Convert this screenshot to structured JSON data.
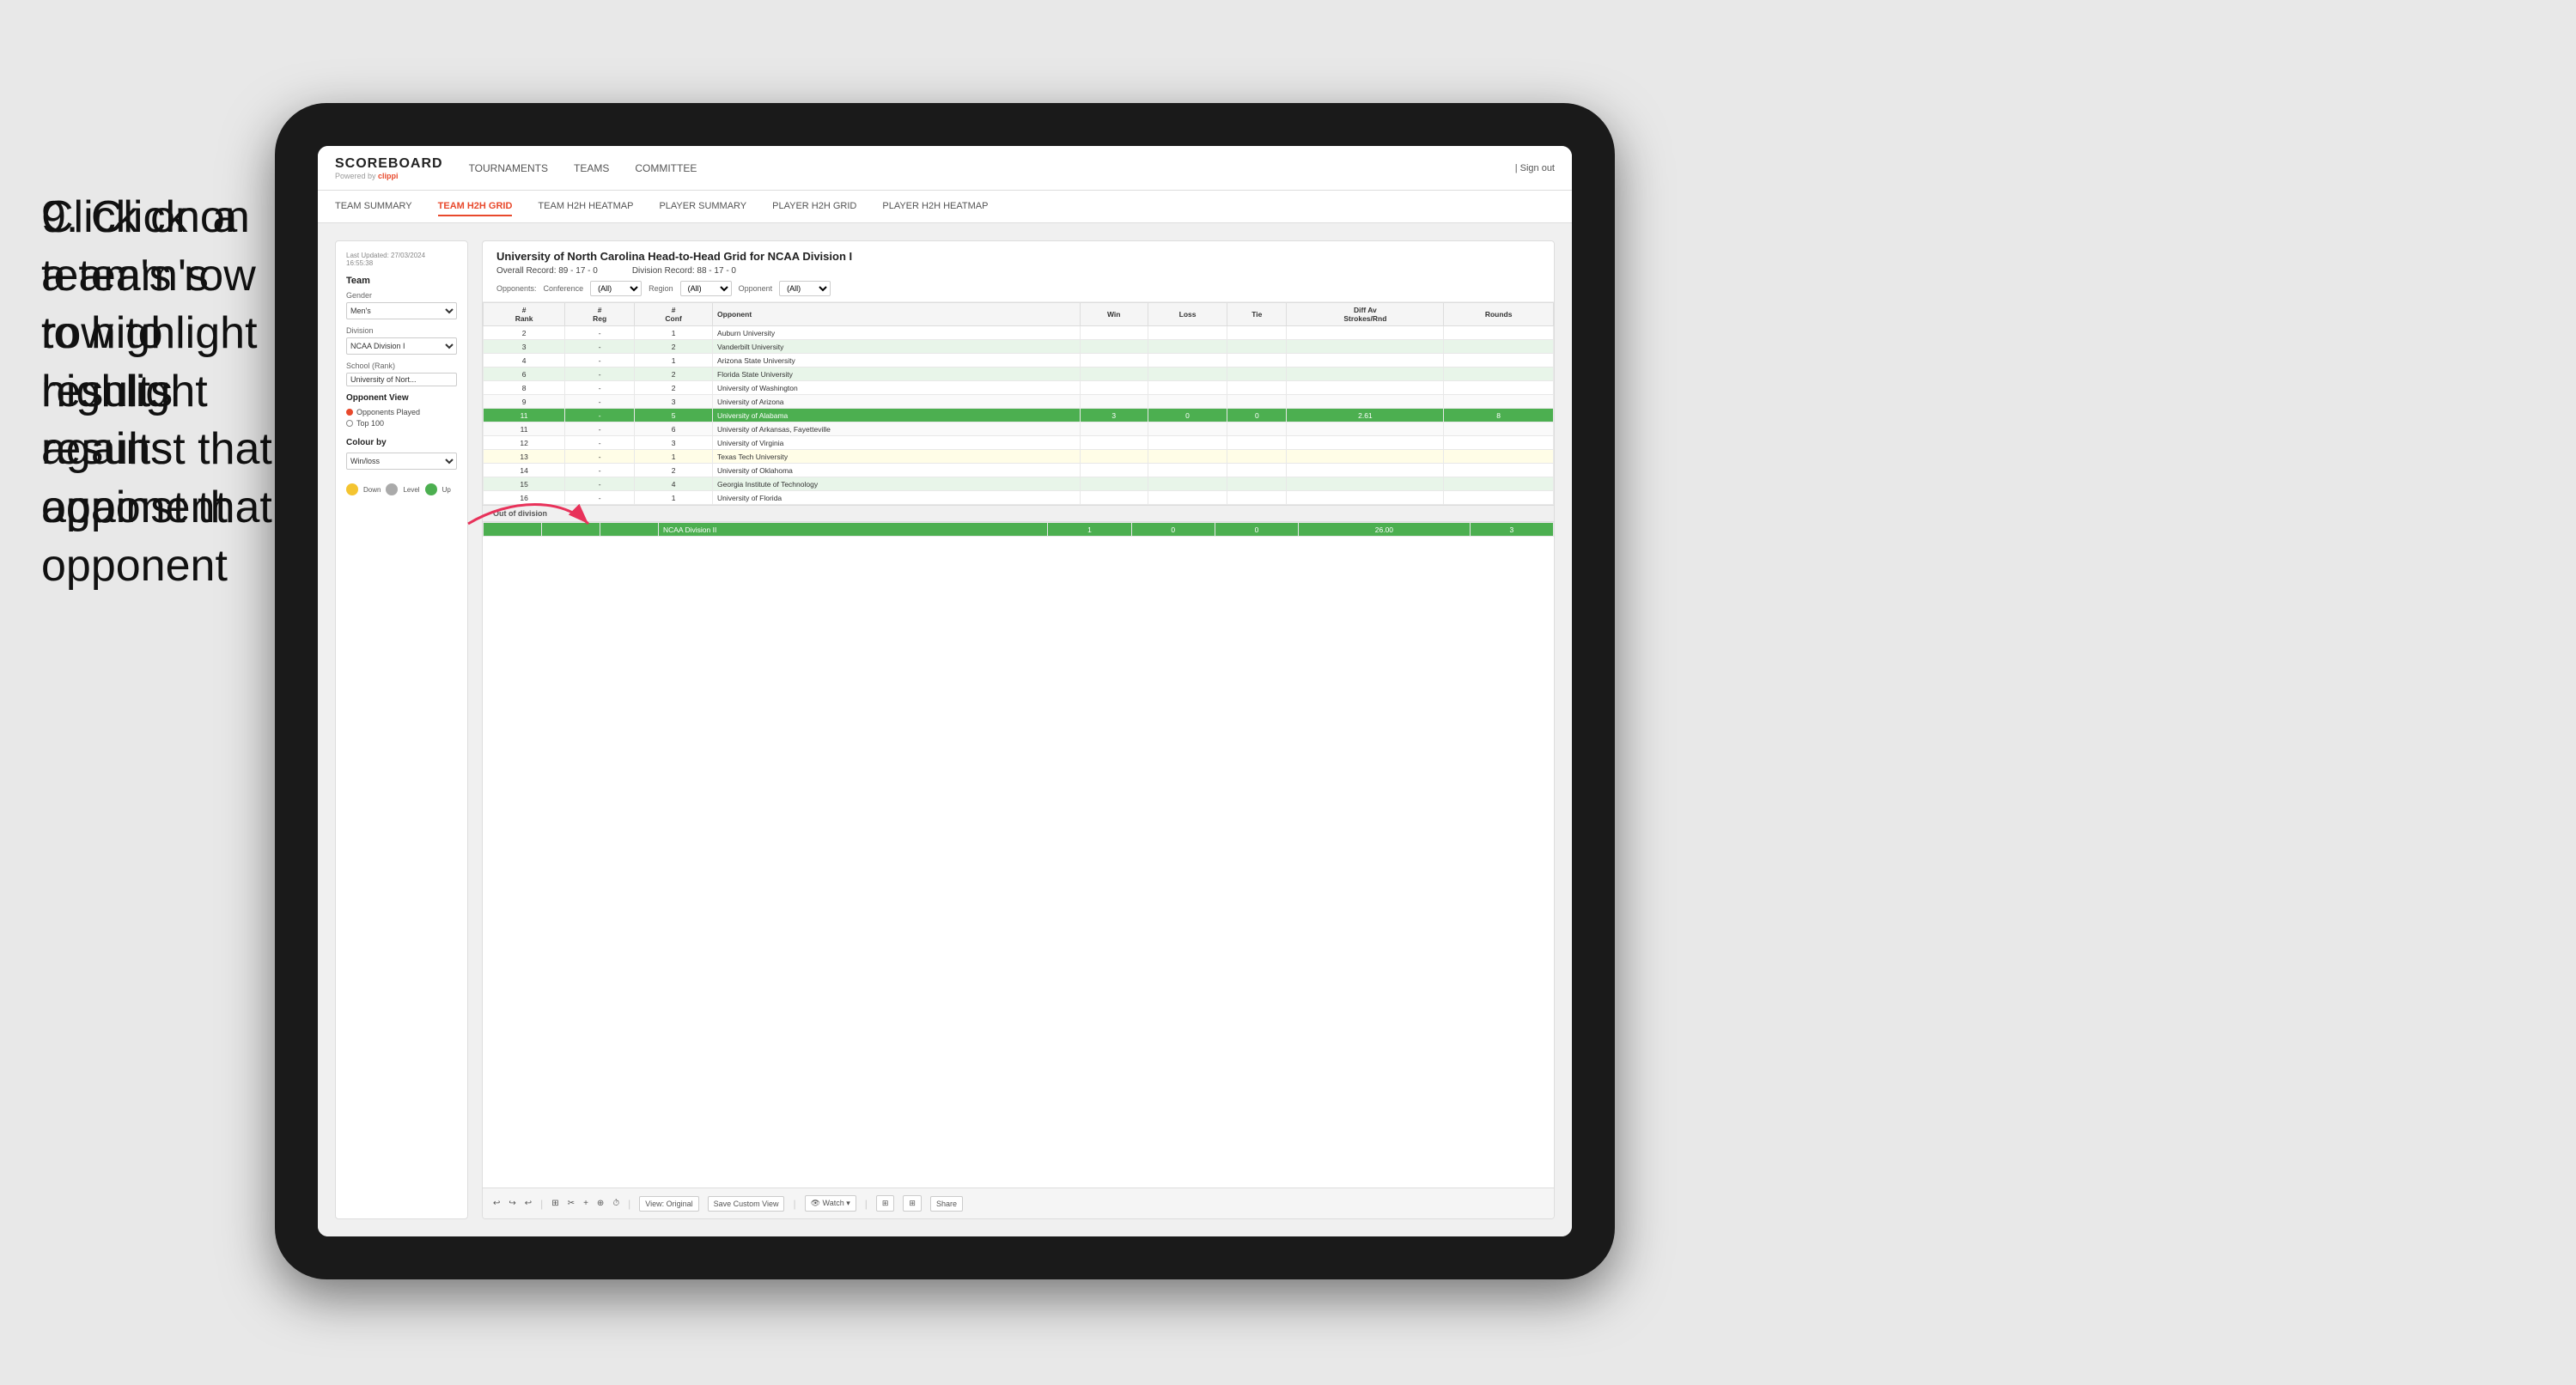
{
  "instruction": {
    "step": "9.",
    "text": "Click on a team's row to highlight results against that opponent"
  },
  "tablet": {
    "topNav": {
      "logo": {
        "title": "SCOREBOARD",
        "subtitle": "Powered by ",
        "brand": "clippi"
      },
      "items": [
        "TOURNAMENTS",
        "TEAMS",
        "COMMITTEE"
      ],
      "signIn": "Sign out"
    },
    "subNav": {
      "items": [
        "TEAM SUMMARY",
        "TEAM H2H GRID",
        "TEAM H2H HEATMAP",
        "PLAYER SUMMARY",
        "PLAYER H2H GRID",
        "PLAYER H2H HEATMAP"
      ],
      "active": "TEAM H2H GRID"
    },
    "leftPanel": {
      "timestamp": "Last Updated: 27/03/2024",
      "time": "16:55:38",
      "teamLabel": "Team",
      "genderLabel": "Gender",
      "genderValue": "Men's",
      "divisionLabel": "Division",
      "divisionValue": "NCAA Division I",
      "schoolLabel": "School (Rank)",
      "schoolValue": "University of Nort...",
      "opponentViewTitle": "Opponent View",
      "radio1": "Opponents Played",
      "radio2": "Top 100",
      "colourByTitle": "Colour by",
      "colourByValue": "Win/loss",
      "legend": [
        {
          "color": "#f4c430",
          "label": "Down"
        },
        {
          "color": "#aaaaaa",
          "label": "Level"
        },
        {
          "color": "#4caf50",
          "label": "Up"
        }
      ]
    },
    "mainTable": {
      "title": "University of North Carolina Head-to-Head Grid for NCAA Division I",
      "overallRecord": "Overall Record: 89 - 17 - 0",
      "divisionRecord": "Division Record: 88 - 17 - 0",
      "filters": {
        "opponentsLabel": "Opponents:",
        "conferenceLabel": "Conference",
        "conferenceValue": "(All)",
        "regionLabel": "Region",
        "regionValue": "(All)",
        "opponentLabel": "Opponent",
        "opponentValue": "(All)"
      },
      "columns": [
        "#\nRank",
        "#\nReg",
        "#\nConf",
        "Opponent",
        "Win",
        "Loss",
        "Tie",
        "Diff Av\nStrokes/Rnd",
        "Rounds"
      ],
      "rows": [
        {
          "rank": "2",
          "reg": "-",
          "conf": "1",
          "opponent": "Auburn University",
          "win": "",
          "loss": "",
          "tie": "",
          "diff": "",
          "rounds": "",
          "highlight": false,
          "rowClass": ""
        },
        {
          "rank": "3",
          "reg": "-",
          "conf": "2",
          "opponent": "Vanderbilt University",
          "win": "",
          "loss": "",
          "tie": "",
          "diff": "",
          "rounds": "",
          "highlight": false,
          "rowClass": "light-green"
        },
        {
          "rank": "4",
          "reg": "-",
          "conf": "1",
          "opponent": "Arizona State University",
          "win": "",
          "loss": "",
          "tie": "",
          "diff": "",
          "rounds": "",
          "highlight": false,
          "rowClass": ""
        },
        {
          "rank": "6",
          "reg": "-",
          "conf": "2",
          "opponent": "Florida State University",
          "win": "",
          "loss": "",
          "tie": "",
          "diff": "",
          "rounds": "",
          "highlight": false,
          "rowClass": "light-green"
        },
        {
          "rank": "8",
          "reg": "-",
          "conf": "2",
          "opponent": "University of Washington",
          "win": "",
          "loss": "",
          "tie": "",
          "diff": "",
          "rounds": "",
          "highlight": false,
          "rowClass": ""
        },
        {
          "rank": "9",
          "reg": "-",
          "conf": "3",
          "opponent": "University of Arizona",
          "win": "",
          "loss": "",
          "tie": "",
          "diff": "",
          "rounds": "",
          "highlight": false,
          "rowClass": ""
        },
        {
          "rank": "11",
          "reg": "-",
          "conf": "5",
          "opponent": "University of Alabama",
          "win": "3",
          "loss": "0",
          "tie": "0",
          "diff": "2.61",
          "rounds": "8",
          "highlight": true,
          "rowClass": "highlighted"
        },
        {
          "rank": "11",
          "reg": "-",
          "conf": "6",
          "opponent": "University of Arkansas, Fayetteville",
          "win": "",
          "loss": "",
          "tie": "",
          "diff": "",
          "rounds": "",
          "highlight": false,
          "rowClass": ""
        },
        {
          "rank": "12",
          "reg": "-",
          "conf": "3",
          "opponent": "University of Virginia",
          "win": "",
          "loss": "",
          "tie": "",
          "diff": "",
          "rounds": "",
          "highlight": false,
          "rowClass": ""
        },
        {
          "rank": "13",
          "reg": "-",
          "conf": "1",
          "opponent": "Texas Tech University",
          "win": "",
          "loss": "",
          "tie": "",
          "diff": "",
          "rounds": "",
          "highlight": false,
          "rowClass": "light-yellow"
        },
        {
          "rank": "14",
          "reg": "-",
          "conf": "2",
          "opponent": "University of Oklahoma",
          "win": "",
          "loss": "",
          "tie": "",
          "diff": "",
          "rounds": "",
          "highlight": false,
          "rowClass": ""
        },
        {
          "rank": "15",
          "reg": "-",
          "conf": "4",
          "opponent": "Georgia Institute of Technology",
          "win": "",
          "loss": "",
          "tie": "",
          "diff": "",
          "rounds": "",
          "highlight": false,
          "rowClass": "light-green"
        },
        {
          "rank": "16",
          "reg": "-",
          "conf": "1",
          "opponent": "University of Florida",
          "win": "",
          "loss": "",
          "tie": "",
          "diff": "",
          "rounds": "",
          "highlight": false,
          "rowClass": ""
        }
      ],
      "outOfDivision": {
        "label": "Out of division",
        "rows": [
          {
            "division": "NCAA Division II",
            "win": "1",
            "loss": "0",
            "tie": "0",
            "diff": "26.00",
            "rounds": "3"
          }
        ]
      }
    },
    "toolbar": {
      "buttons": [
        "↩",
        "↪",
        "↩",
        "⊞",
        "✂",
        "+",
        "⊕",
        "🕐",
        "View: Original",
        "Save Custom View",
        "👁 Watch ▾",
        "⊞",
        "⊞",
        "Share"
      ]
    }
  }
}
